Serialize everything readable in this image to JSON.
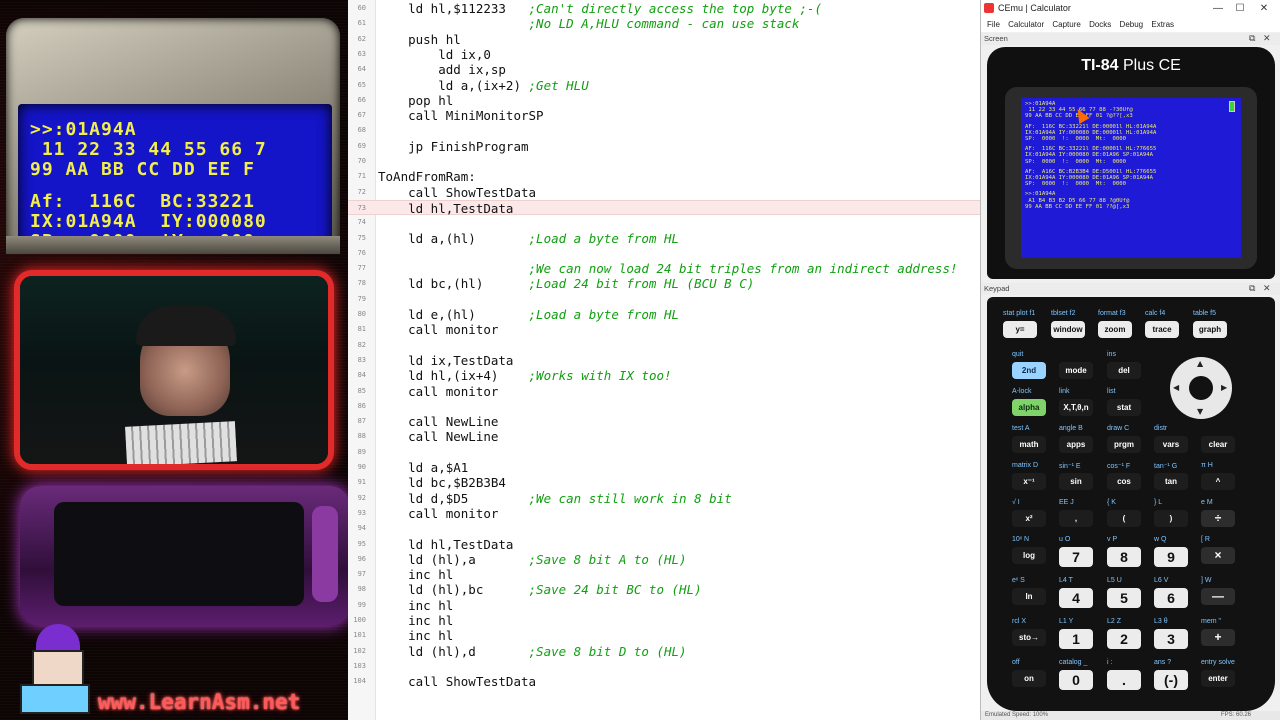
{
  "overlay": {
    "crt_lines": [
      ">>:01A94A",
      " 11 22 33 44 55 66 7",
      "99 AA BB CC DD EE F",
      "Af:  116C  BC:33221",
      "IX:01A94A  IY:000080",
      "SP:  0000  !Y:  000"
    ],
    "site_url": "www.LearnAsm.net"
  },
  "editor": {
    "lines": [
      {
        "n": "60",
        "code": "    ld hl,$112233",
        "comment": ";Can't directly access the top byte ;-("
      },
      {
        "n": "61",
        "code": "                   ",
        "comment": ";No LD A,HLU command - can use stack"
      },
      {
        "n": "62",
        "code": "    push hl",
        "comment": ""
      },
      {
        "n": "63",
        "code": "        ld ix,0",
        "comment": ""
      },
      {
        "n": "64",
        "code": "        add ix,sp",
        "comment": ""
      },
      {
        "n": "65",
        "code": "        ld a,(ix+2)",
        "comment": ";Get HLU"
      },
      {
        "n": "66",
        "code": "    pop hl",
        "comment": ""
      },
      {
        "n": "67",
        "code": "    call MiniMonitorSP",
        "comment": ""
      },
      {
        "n": "68",
        "code": "",
        "comment": ""
      },
      {
        "n": "69",
        "code": "    jp FinishProgram",
        "comment": ""
      },
      {
        "n": "70",
        "code": "",
        "comment": ""
      },
      {
        "n": "71",
        "code": "ToAndFromRam:",
        "comment": ""
      },
      {
        "n": "72",
        "code": "    call ShowTestData",
        "comment": ""
      },
      {
        "n": "73",
        "code": "    ld hl,TestData",
        "comment": ""
      },
      {
        "n": "74",
        "code": "",
        "comment": ""
      },
      {
        "n": "75",
        "code": "    ld a,(hl)",
        "comment": ";Load a byte from HL"
      },
      {
        "n": "76",
        "code": "",
        "comment": ""
      },
      {
        "n": "77",
        "code": "    ",
        "comment": ";We can now load 24 bit triples from an indirect address!"
      },
      {
        "n": "78",
        "code": "    ld bc,(hl)",
        "comment": ";Load 24 bit from HL (BCU B C)"
      },
      {
        "n": "79",
        "code": "",
        "comment": ""
      },
      {
        "n": "80",
        "code": "    ld e,(hl)",
        "comment": ";Load a byte from HL"
      },
      {
        "n": "81",
        "code": "    call monitor",
        "comment": ""
      },
      {
        "n": "82",
        "code": "",
        "comment": ""
      },
      {
        "n": "83",
        "code": "    ld ix,TestData",
        "comment": ""
      },
      {
        "n": "84",
        "code": "    ld hl,(ix+4)",
        "comment": ";Works with IX too!"
      },
      {
        "n": "85",
        "code": "    call monitor",
        "comment": ""
      },
      {
        "n": "86",
        "code": "",
        "comment": ""
      },
      {
        "n": "87",
        "code": "    call NewLine",
        "comment": ""
      },
      {
        "n": "88",
        "code": "    call NewLine",
        "comment": ""
      },
      {
        "n": "89",
        "code": "",
        "comment": ""
      },
      {
        "n": "90",
        "code": "    ld a,$A1",
        "comment": ""
      },
      {
        "n": "91",
        "code": "    ld bc,$B2B3B4",
        "comment": ""
      },
      {
        "n": "92",
        "code": "    ld d,$D5",
        "comment": ";We can still work in 8 bit"
      },
      {
        "n": "93",
        "code": "    call monitor",
        "comment": ""
      },
      {
        "n": "94",
        "code": "",
        "comment": ""
      },
      {
        "n": "95",
        "code": "    ld hl,TestData",
        "comment": ""
      },
      {
        "n": "96",
        "code": "    ld (hl),a",
        "comment": ";Save 8 bit A to (HL)"
      },
      {
        "n": "97",
        "code": "    inc hl",
        "comment": ""
      },
      {
        "n": "98",
        "code": "    ld (hl),bc",
        "comment": ";Save 24 bit BC to (HL)"
      },
      {
        "n": "99",
        "code": "    inc hl",
        "comment": ""
      },
      {
        "n": "100",
        "code": "    inc hl",
        "comment": ""
      },
      {
        "n": "101",
        "code": "    inc hl",
        "comment": ""
      },
      {
        "n": "102",
        "code": "    ld (hl),d",
        "comment": ";Save 8 bit D to (HL)"
      },
      {
        "n": "103",
        "code": "",
        "comment": ""
      },
      {
        "n": "104",
        "code": "    call ShowTestData",
        "comment": ""
      }
    ],
    "current_line": "73"
  },
  "cemu": {
    "window_title": "CEmu | Calculator",
    "menu": [
      "File",
      "Calculator",
      "Capture",
      "Docks",
      "Debug",
      "Extras"
    ],
    "screen_panel": "Screen",
    "keypad_panel": "Keypad",
    "brand_bold": "TI-84",
    "brand_rest": " Plus CE",
    "lcd_lines": [
      ">>:01A94A",
      " 11 22 33 44 55 66 77 88 -?30Uf@",
      "99 AA BB CC DD EE FF 01 ?@??[,x3",
      "AF:  116C BC:33221l DE:00001l HL:01A94A",
      "IX:01A94A IY:000080 DE:00001l HL:01A94A",
      "SP:  0000  !:  0000  Mt:  0000",
      "AF:  116C BC:33221l DE:00001l HL:776655",
      "IX:01A94A IY:000080 DE:01A96 SP:01A94A",
      "SP:  0000  !:  0000  Mt:  0000",
      "AF:  A16C BC:B2B3B4 DE:D5001l HL:776655",
      "IX:01A94A IY:000080 DE:01A96 SP:01A94A",
      "SP:  0000  !:  0000  Mt:  0000",
      ">>:01A94A",
      " A1 B4 B3 B2 D5 66 77 88 ?@0Uf@",
      "99 AA BB CC DD EE FF 01 ??@[,x3"
    ],
    "status_left": "Emulated Speed: 100%",
    "status_right": "FPS: 60.26",
    "fkeys": [
      {
        "top": "stat plot f1",
        "label": "y="
      },
      {
        "top": "tblset f2",
        "label": "window"
      },
      {
        "top": "format f3",
        "label": "zoom"
      },
      {
        "top": "calc f4",
        "label": "trace"
      },
      {
        "top": "table f5",
        "label": "graph"
      }
    ],
    "row2": [
      {
        "top": "quit",
        "label": "2nd",
        "style": "blue"
      },
      {
        "top": "",
        "label": "mode",
        "style": "dark"
      },
      {
        "top": "ins",
        "label": "del",
        "style": "dark"
      }
    ],
    "row3": [
      {
        "top": "A-lock",
        "label": "alpha",
        "style": "green"
      },
      {
        "top": "link",
        "label": "X,T,θ,n",
        "style": "dark"
      },
      {
        "top": "list",
        "label": "stat",
        "style": "dark"
      }
    ],
    "row4": [
      {
        "top": "test A",
        "label": "math"
      },
      {
        "top": "angle B",
        "label": "apps"
      },
      {
        "top": "draw C",
        "label": "prgm"
      },
      {
        "top": "distr",
        "label": "vars"
      },
      {
        "top": "",
        "label": "clear"
      }
    ],
    "row5": [
      {
        "top": "matrix D",
        "label": "x⁻¹"
      },
      {
        "top": "sin⁻¹ E",
        "label": "sin"
      },
      {
        "top": "cos⁻¹ F",
        "label": "cos"
      },
      {
        "top": "tan⁻¹ G",
        "label": "tan"
      },
      {
        "top": "π H",
        "label": "^"
      }
    ],
    "row6": [
      {
        "top": "√ I",
        "label": "x²"
      },
      {
        "top": "EE J",
        "label": ","
      },
      {
        "top": "{ K",
        "label": "("
      },
      {
        "top": "} L",
        "label": ")"
      },
      {
        "top": "e M",
        "label": "÷"
      }
    ],
    "row7": [
      {
        "top": "10ˣ N",
        "label": "log"
      },
      {
        "top": "u O",
        "label": "7"
      },
      {
        "top": "v P",
        "label": "8"
      },
      {
        "top": "w Q",
        "label": "9"
      },
      {
        "top": "[ R",
        "label": "×"
      }
    ],
    "row8": [
      {
        "top": "eˣ S",
        "label": "ln"
      },
      {
        "top": "L4 T",
        "label": "4"
      },
      {
        "top": "L5 U",
        "label": "5"
      },
      {
        "top": "L6 V",
        "label": "6"
      },
      {
        "top": "] W",
        "label": "—"
      }
    ],
    "row9": [
      {
        "top": "rcl X",
        "label": "sto→"
      },
      {
        "top": "L1 Y",
        "label": "1"
      },
      {
        "top": "L2 Z",
        "label": "2"
      },
      {
        "top": "L3 θ",
        "label": "3"
      },
      {
        "top": "mem \"",
        "label": "+"
      }
    ],
    "row10": [
      {
        "top": "off",
        "label": "on"
      },
      {
        "top": "catalog _",
        "label": "0"
      },
      {
        "top": "i :",
        "label": "."
      },
      {
        "top": "ans ?",
        "label": "(-)"
      },
      {
        "top": "entry solve",
        "label": "enter"
      }
    ],
    "colors": {
      "lcd_bg": "#1e1ad6",
      "lcd_text": "#ecec70",
      "second_key": "#9ad3ff",
      "alpha_key": "#7fd36a",
      "comment": "#11a011"
    }
  }
}
